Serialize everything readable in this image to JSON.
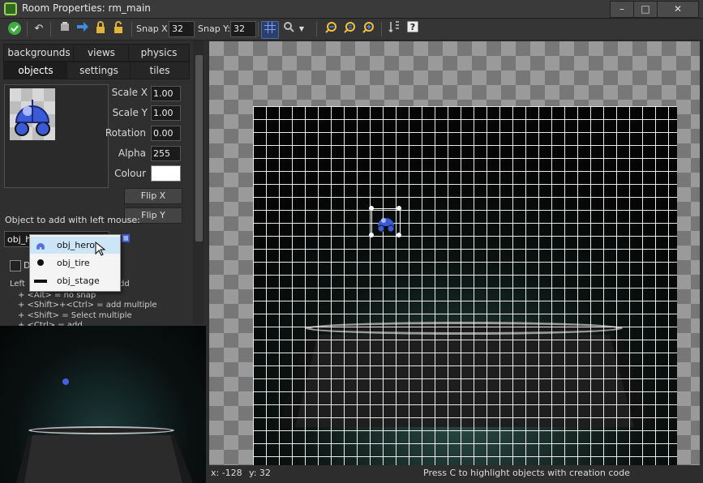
{
  "window": {
    "title": "Room Properties: rm_main",
    "controls": {
      "minimize": "–",
      "maximize": "□",
      "close": "✕"
    }
  },
  "toolbar": {
    "snap_x_label": "Snap X:",
    "snap_x_value": "32",
    "snap_y_label": "Snap Y:",
    "snap_y_value": "32"
  },
  "tabs": {
    "row1": [
      "backgrounds",
      "views",
      "physics"
    ],
    "row2": [
      "objects",
      "settings",
      "tiles"
    ],
    "active": "objects"
  },
  "object_props": {
    "scale_x_label": "Scale X",
    "scale_x_value": "1.00",
    "scale_y_label": "Scale Y",
    "scale_y_value": "1.00",
    "rotation_label": "Rotation",
    "rotation_value": "0.00",
    "alpha_label": "Alpha",
    "alpha_value": "255",
    "colour_label": "Colour",
    "colour_value": "#ffffff",
    "flip_x_label": "Flip X",
    "flip_y_label": "Flip Y"
  },
  "object_select": {
    "label": "Object to add with left mouse:",
    "current_value": "obj_he",
    "options": [
      "obj_hero",
      "obj_tire",
      "obj_stage"
    ],
    "selected": "obj_hero"
  },
  "delete_checkbox_label": "D",
  "help": {
    "line1": "Left",
    "line1_tail": "dd",
    "line2": "+ <Alt> = no snap",
    "line3": "+ <Shift>+<Ctrl> = add multiple",
    "line4": "+ <Shift> = Select multiple",
    "line5": "+ <Ctrl> = add"
  },
  "status": {
    "x": "x: -128",
    "y": "y: 32",
    "hint": "Press C to highlight objects with creation code"
  },
  "colors": {
    "accent": "#3b5bd6",
    "selection": "#cde6f7"
  }
}
